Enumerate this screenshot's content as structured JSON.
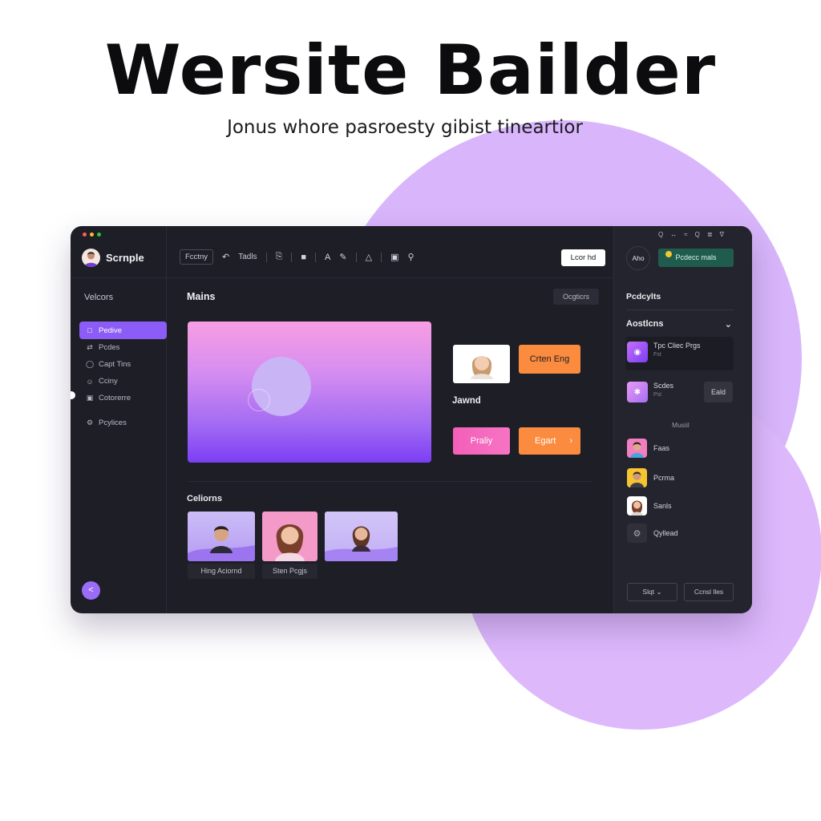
{
  "hero": {
    "title": "Wersite  Bailder",
    "subtitle": "Jonus whore pasroesty gibist tineartiоr"
  },
  "colors": {
    "accent": "#8b5cf6",
    "orange": "#fb8b3f",
    "pink": "#f35fb9",
    "green": "#1f5c4d",
    "window_bg": "#1d1e26",
    "blob": "#d9b6fb"
  },
  "window": {
    "dots": [
      "#ff5f57",
      "#febc2e",
      "#28c840"
    ],
    "brand": {
      "name": "Scrnple",
      "avatar_icon": "user-avatar-icon"
    },
    "toolbar": {
      "factory_label": "Fcctny",
      "tools_label": "Tadls",
      "login_label": "Lcor hd"
    },
    "sidebar": {
      "heading": "Velcors",
      "items": [
        {
          "label": "Pedive",
          "icon": "page-icon",
          "active": true
        },
        {
          "label": "Pcdes",
          "icon": "code-icon",
          "active": false
        },
        {
          "label": "Capt Tins",
          "icon": "clock-icon",
          "active": false
        },
        {
          "label": "Cciny",
          "icon": "user-icon",
          "active": false
        },
        {
          "label": "Cotorerre",
          "icon": "palette-icon",
          "active": false
        },
        {
          "label": "Pcylices",
          "icon": "settings-icon",
          "active": false
        }
      ],
      "fab_glyph": "<"
    },
    "main": {
      "title": "Mains",
      "options_label": "Ocgticrs",
      "cta_orange": "Crten Eng",
      "section_label": "Jawnd",
      "btn_pink": "Praliy",
      "btn_egart": "Egart",
      "btn_egart_chevron": "›",
      "gallery_title": "Celiorns",
      "gallery": [
        {
          "caption": "Hing Aciornd"
        },
        {
          "caption": "Sten Pcgjs"
        },
        {
          "caption": ""
        }
      ]
    },
    "right_panel": {
      "top_icons": [
        "Q",
        "↔",
        "≈",
        "Q",
        "≣",
        "∇"
      ],
      "circle_label": "Aho",
      "green_label": "Pcdecc mals",
      "title": "Pcdcylts",
      "section": "Aostlcns",
      "section_chevron": "⌄",
      "card1": {
        "title": "Tpc Cliec Prgs",
        "sub": "Fst"
      },
      "card2": {
        "title": "Scdes",
        "sub": "Pst",
        "edit": "Eald"
      },
      "music_label": "Musiil",
      "items": [
        {
          "label": "Faas",
          "icon": "person-avatar-icon"
        },
        {
          "label": "Pcrma",
          "icon": "person-avatar-icon"
        },
        {
          "label": "Sanls",
          "icon": "person-avatar-icon"
        },
        {
          "label": "Qyllead",
          "icon": "gear-icon"
        }
      ],
      "select_label": "Slqt",
      "select_chevron": "⌄",
      "create_label": "Ccnsl lles"
    }
  }
}
